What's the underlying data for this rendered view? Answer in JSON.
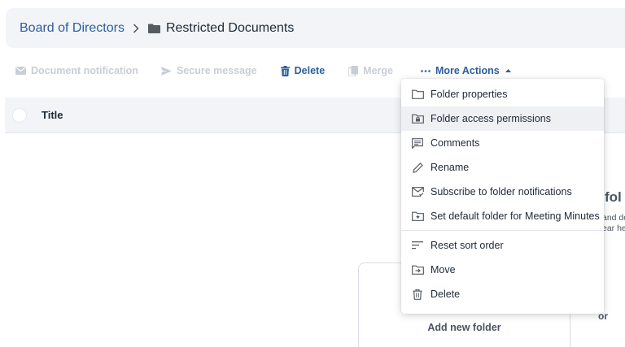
{
  "breadcrumb": {
    "parent": "Board of Directors",
    "current": "Restricted Documents"
  },
  "toolbar": {
    "document_notification": "Document notification",
    "secure_message": "Secure message",
    "delete": "Delete",
    "merge": "Merge",
    "more_actions": "More Actions"
  },
  "table": {
    "title_header": "Title"
  },
  "empty_state": {
    "title_fragment": "fol",
    "line1_fragment": "and do",
    "line2_fragment": "ear he",
    "or": "or",
    "add_folder": "Add new folder"
  },
  "menu": {
    "items": [
      {
        "label": "Folder properties",
        "icon": "folder-icon"
      },
      {
        "label": "Folder access permissions",
        "icon": "folder-lock-icon"
      },
      {
        "label": "Comments",
        "icon": "comment-icon"
      },
      {
        "label": "Rename",
        "icon": "pencil-icon"
      },
      {
        "label": "Subscribe to folder notifications",
        "icon": "mail-check-icon"
      },
      {
        "label": "Set default folder for Meeting Minutes",
        "icon": "folder-star-icon"
      },
      {
        "label": "Reset sort order",
        "icon": "sort-icon"
      },
      {
        "label": "Move",
        "icon": "folder-move-icon"
      },
      {
        "label": "Delete",
        "icon": "trash-icon"
      }
    ]
  },
  "colors": {
    "link": "#2c5e9e",
    "disabled": "#c9ced6",
    "header_bg": "#f2f4f7",
    "menu_highlight": "#eef0f3"
  }
}
